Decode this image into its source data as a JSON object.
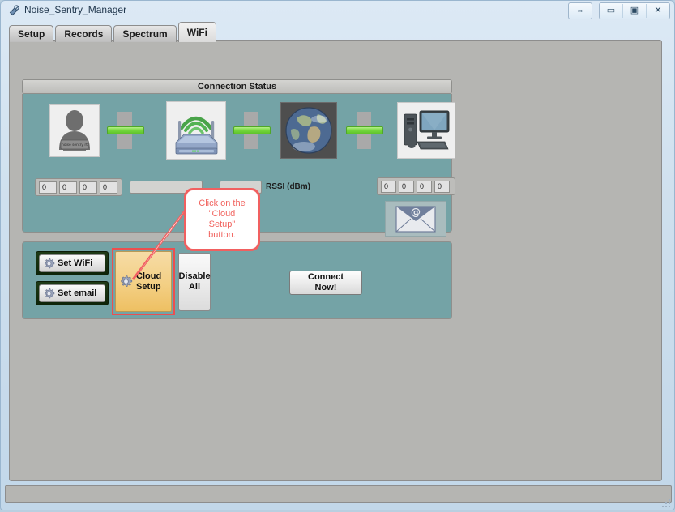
{
  "window": {
    "title": "Noise_Sentry_Manager",
    "app_icon": "app-icon",
    "buttons": {
      "resize": "⇔",
      "minimize": "▭",
      "maximize": "▣",
      "close": "✕"
    }
  },
  "tabs": [
    {
      "label": "Setup",
      "active": false
    },
    {
      "label": "Records",
      "active": false
    },
    {
      "label": "Spectrum",
      "active": false
    },
    {
      "label": "WiFi",
      "active": true
    }
  ],
  "connection_status": {
    "header": "Connection Status",
    "chain": [
      {
        "name": "sensor-icon",
        "caption": "noise sentry rt"
      },
      {
        "name": "router-icon",
        "caption": ""
      },
      {
        "name": "globe-icon",
        "caption": ""
      },
      {
        "name": "computer-icon",
        "caption": ""
      }
    ],
    "links": [
      {
        "state": "active"
      },
      {
        "state": "active"
      },
      {
        "state": "active"
      }
    ],
    "device_ip": [
      "0",
      "0",
      "0",
      "0"
    ],
    "ssid_value": "",
    "rssi_value": "",
    "rssi_label": "RSSI (dBm)",
    "server_ip": [
      "0",
      "0",
      "0",
      "0"
    ],
    "mail_button": "@"
  },
  "callout": {
    "text": "Click on the\n\"Cloud\nSetup\"\nbutton.",
    "border_color": "#f16060",
    "text_color": "#f1645f"
  },
  "actions": {
    "set_wifi": "Set WiFi",
    "set_email": "Set email",
    "cloud_setup": "Cloud\nSetup",
    "disable_all": "Disable\nAll",
    "connect_now": "Connect\nNow!"
  },
  "colors": {
    "panel_teal": "#74a3a6",
    "page_gray": "#b5b5b2",
    "highlight_red": "#ec4f4f",
    "cloud_orange": "#f3cf84",
    "link_green": "#76d83f",
    "green_frame": "#1e3a16"
  },
  "statusbar": {
    "text": ""
  }
}
